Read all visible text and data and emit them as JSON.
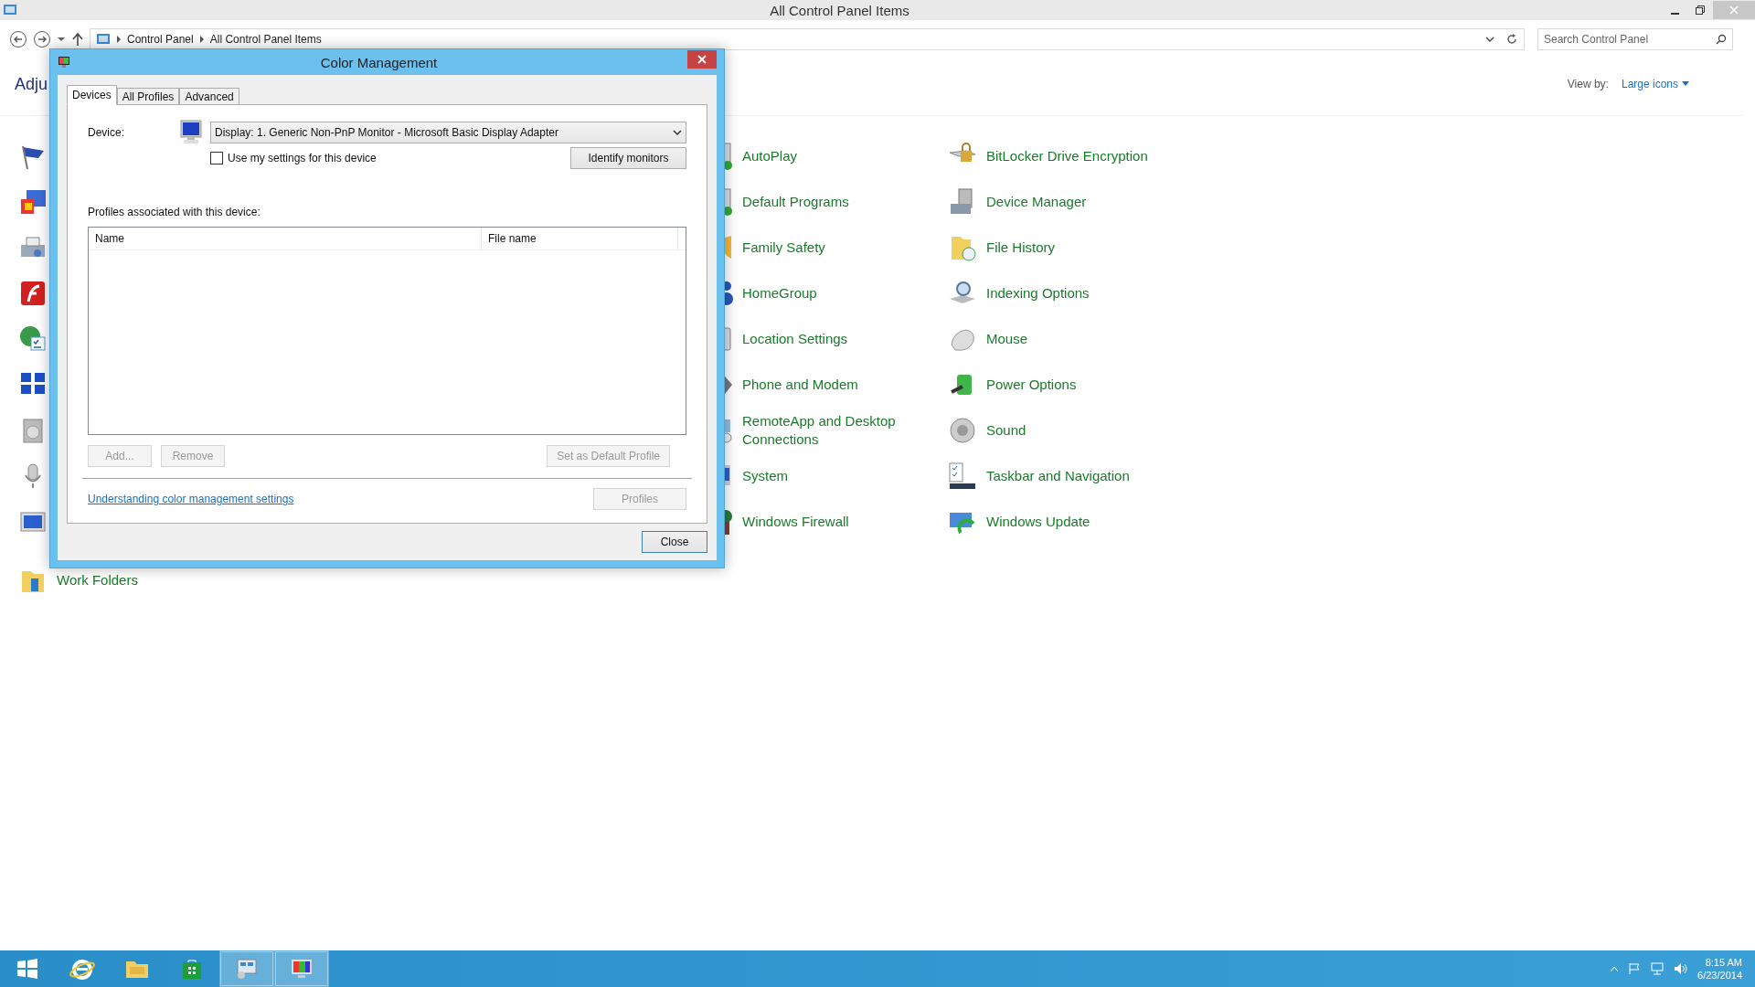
{
  "window": {
    "title": "All Control Panel Items"
  },
  "address_bar": {
    "breadcrumbs": [
      {
        "label": "Control Panel"
      },
      {
        "label": "All Control Panel Items"
      }
    ]
  },
  "search": {
    "placeholder": "Search Control Panel"
  },
  "heading": "Adju",
  "view_by": {
    "label": "View by:",
    "value": "Large icons"
  },
  "column_1": [
    {
      "label": "Work Folders"
    }
  ],
  "column_2": [
    {
      "label": "AutoPlay"
    },
    {
      "label": "Default Programs"
    },
    {
      "label": "Family Safety"
    },
    {
      "label": "HomeGroup"
    },
    {
      "label": "Location Settings"
    },
    {
      "label": "Phone and Modem"
    },
    {
      "label": "RemoteApp and Desktop Connections"
    },
    {
      "label": "System"
    },
    {
      "label": "Windows Firewall"
    }
  ],
  "column_3": [
    {
      "label": "BitLocker Drive Encryption"
    },
    {
      "label": "Device Manager"
    },
    {
      "label": "File History"
    },
    {
      "label": "Indexing Options"
    },
    {
      "label": "Mouse"
    },
    {
      "label": "Power Options"
    },
    {
      "label": "Sound"
    },
    {
      "label": "Taskbar and Navigation"
    },
    {
      "label": "Windows Update"
    }
  ],
  "dialog": {
    "title": "Color Management",
    "tabs": [
      {
        "label": "Devices",
        "selected": true
      },
      {
        "label": "All Profiles",
        "selected": false
      },
      {
        "label": "Advanced",
        "selected": false
      }
    ],
    "device_label": "Device:",
    "device_value": "Display: 1. Generic Non-PnP Monitor - Microsoft Basic Display Adapter",
    "use_my_settings": {
      "label": "Use my settings for this device",
      "checked": false
    },
    "identify_button": {
      "label": "Identify monitors",
      "disabled": false
    },
    "profiles_label": "Profiles associated with this device:",
    "table": {
      "columns": [
        "Name",
        "File name"
      ]
    },
    "buttons": [
      {
        "label": "Add...",
        "disabled": true
      },
      {
        "label": "Remove",
        "disabled": true
      },
      {
        "label": "Set as Default Profile",
        "disabled": true
      }
    ],
    "profiles_button": {
      "label": "Profiles",
      "disabled": true
    },
    "link": "Understanding color management settings",
    "close_button": {
      "label": "Close",
      "disabled": false
    }
  },
  "taskbar": {
    "apps": [
      {
        "selected": false
      },
      {
        "selected": false
      },
      {
        "selected": false
      },
      {
        "selected": false
      },
      {
        "selected": true
      },
      {
        "selected": true
      }
    ],
    "time": "8:15 AM",
    "date": "6/23/2014"
  }
}
